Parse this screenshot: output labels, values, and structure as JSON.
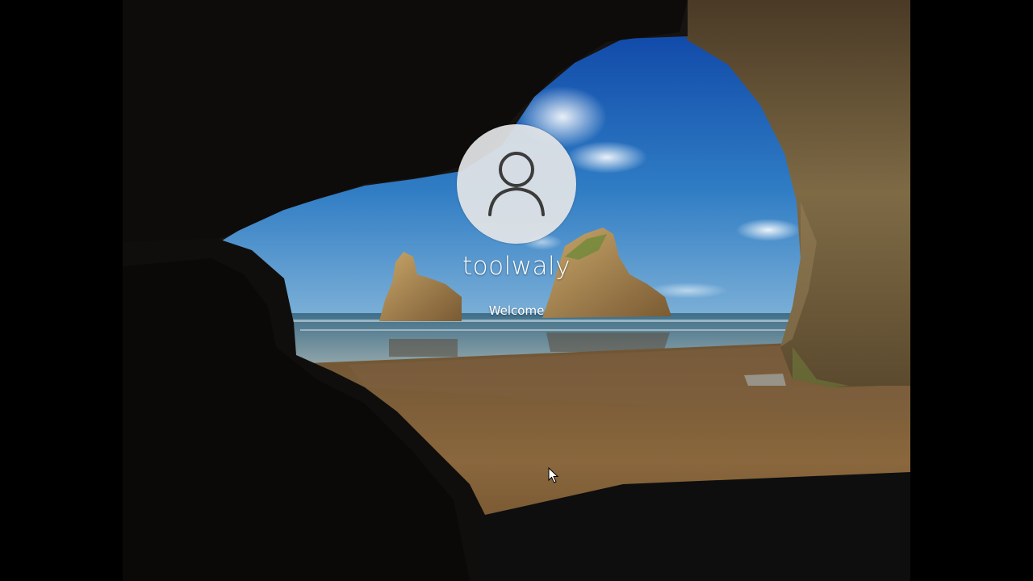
{
  "login": {
    "username": "toolwaly",
    "status_text": "Welcome"
  },
  "icons": {
    "avatar": "user-silhouette-icon",
    "cursor": "mouse-pointer-icon"
  },
  "colors": {
    "avatar_bg": "#e2e4e6",
    "text": "#ffffff",
    "sky": "#2a6fb5",
    "sand": "#8a6a3e"
  }
}
